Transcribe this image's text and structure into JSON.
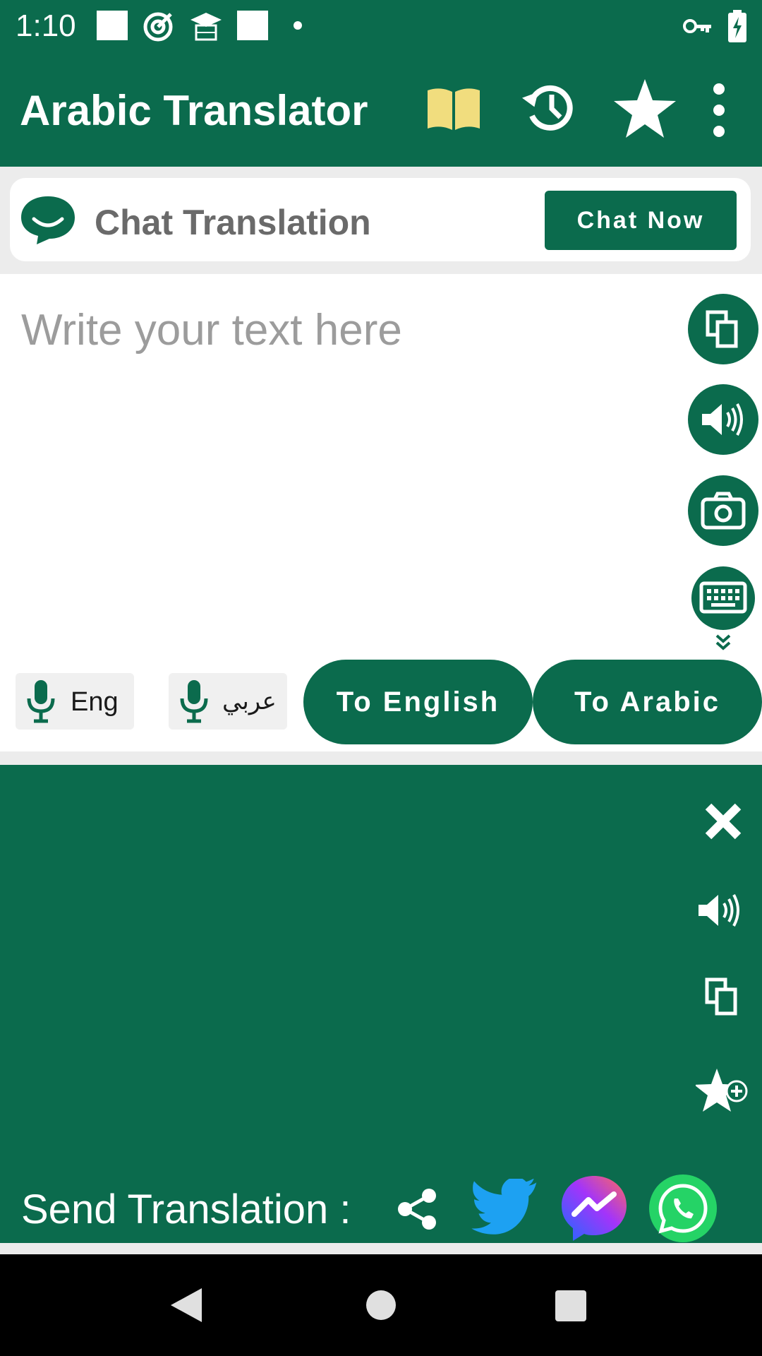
{
  "status_bar": {
    "time": "1:10",
    "icons": [
      "notification-square",
      "target-icon",
      "graduation-cap-icon",
      "notification-square",
      "dot",
      "vpn-key-icon",
      "battery-charging-icon"
    ]
  },
  "app_bar": {
    "title": "Arabic Translator",
    "actions": [
      "book-icon",
      "history-icon",
      "star-icon",
      "more-vert-icon"
    ]
  },
  "chat_card": {
    "label": "Chat Translation",
    "button": "Chat Now"
  },
  "input": {
    "placeholder": "Write your text here",
    "side_actions": [
      "copy-icon",
      "speaker-icon",
      "camera-icon",
      "keyboard-icon"
    ]
  },
  "language_buttons": {
    "mic_english": "Eng",
    "mic_arabic": "عربي",
    "to_english": "To English",
    "to_arabic": "To Arabic"
  },
  "output": {
    "side_actions": [
      "close-icon",
      "speaker-icon",
      "copy-icon",
      "favorite-add-icon"
    ],
    "send_label": "Send Translation :",
    "share_targets": [
      "share-icon",
      "twitter-icon",
      "messenger-icon",
      "whatsapp-icon"
    ]
  },
  "nav_bar": [
    "back-button",
    "home-button",
    "recents-button"
  ],
  "colors": {
    "primary": "#0b6b4d",
    "book": "#f1dd7e",
    "twitter": "#1da1f2",
    "whatsapp": "#25d366",
    "messenger_start": "#1e6bff",
    "messenger_end": "#ff4f7b"
  }
}
